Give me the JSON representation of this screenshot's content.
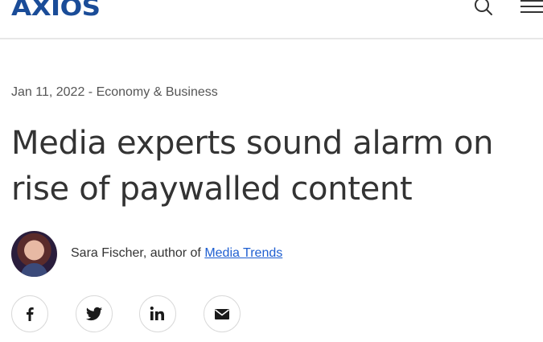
{
  "header": {
    "logo_text": "AXIOS",
    "search_icon": "search-icon",
    "menu_icon": "hamburger-menu-icon"
  },
  "article": {
    "date": "Jan 11, 2022",
    "separator": " - ",
    "category": "Economy & Business",
    "headline": "Media experts sound alarm on rise of paywalled content",
    "byline": {
      "prefix": "Sara Fischer, author of ",
      "newsletter": "Media Trends"
    }
  },
  "share": {
    "buttons": [
      {
        "icon": "facebook-icon"
      },
      {
        "icon": "twitter-icon"
      },
      {
        "icon": "linkedin-icon"
      },
      {
        "icon": "email-icon"
      }
    ]
  },
  "colors": {
    "brand": "#1a4c98",
    "link": "#1f5fd1",
    "text": "#333333",
    "divider": "#e7e7e7"
  }
}
